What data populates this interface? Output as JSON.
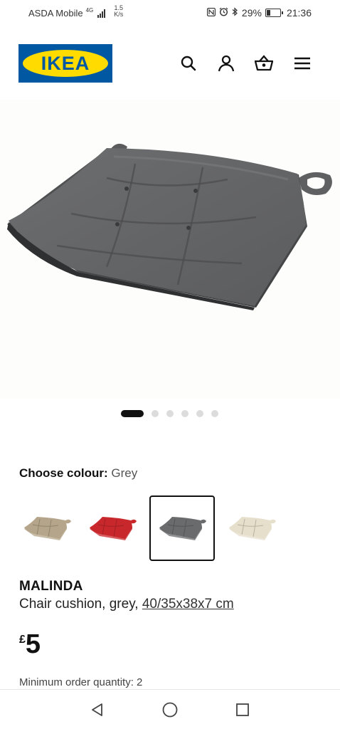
{
  "status_bar": {
    "carrier": "ASDA Mobile",
    "network_type": "4G",
    "speed_value": "1.5",
    "speed_unit": "K/s",
    "battery": "29%",
    "battery_level": 0.29,
    "time": "21:36",
    "icons": [
      "nfc-icon",
      "alarm-icon",
      "bluetooth-icon"
    ]
  },
  "header": {
    "logo_text": "IKEA",
    "brand_colors": {
      "blue": "#0058a3",
      "yellow": "#ffdb00"
    },
    "icons": [
      "search-icon",
      "profile-icon",
      "basket-icon",
      "menu-icon"
    ]
  },
  "gallery": {
    "image": "grey-chair-cushion",
    "dot_count": 6,
    "active_index": 0
  },
  "colour": {
    "label": "Choose colour:",
    "selected": "Grey",
    "swatches": [
      {
        "name": "beige",
        "color": "#b5a58a"
      },
      {
        "name": "red",
        "color": "#c8282c"
      },
      {
        "name": "grey",
        "color": "#6a6b6d",
        "selected": true
      },
      {
        "name": "natural",
        "color": "#e6dfcc"
      }
    ]
  },
  "product": {
    "name": "MALINDA",
    "description": "Chair cushion, grey, ",
    "dimensions": "40/35x38x7 cm",
    "currency": "£",
    "price": "5",
    "min_order": "Minimum order quantity: 2"
  },
  "navigation": {
    "buttons": [
      "back",
      "home",
      "recents"
    ]
  }
}
